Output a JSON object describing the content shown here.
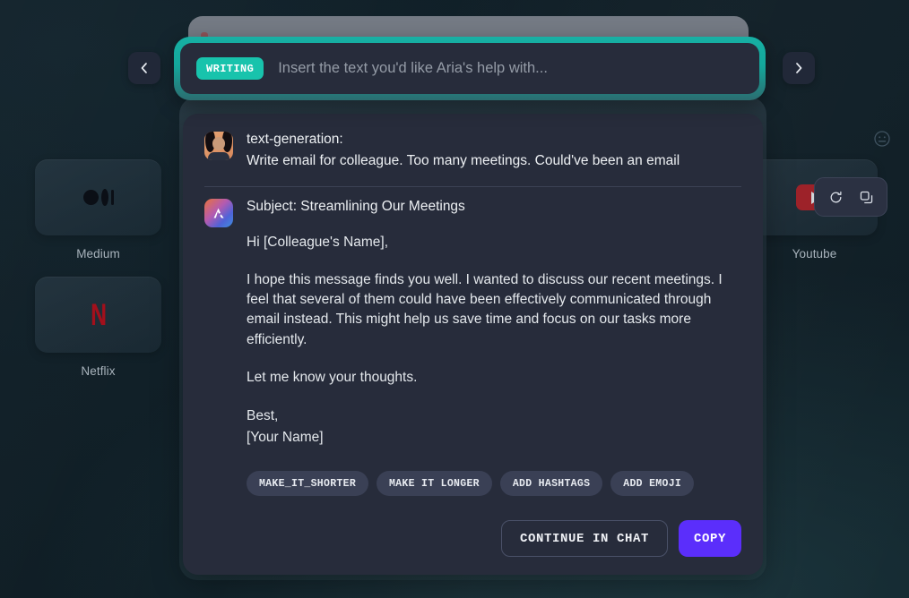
{
  "colors": {
    "background": "#0e1b22",
    "panel": "#272c3b",
    "accent_teal": "#18c3ac",
    "accent_purple": "#5b2efb",
    "chip": "#3a4055",
    "netflix_red": "#a3101c",
    "youtube_red": "#9d2229"
  },
  "nav": {
    "prev_icon": "chevron-left-icon",
    "next_icon": "chevron-right-icon"
  },
  "smiley": {
    "icon": "smiley-face-icon"
  },
  "shortcuts": {
    "left": [
      {
        "label": "Medium",
        "icon": "medium-logo-icon"
      },
      {
        "label": "Netflix",
        "icon": "netflix-logo-icon",
        "glyph": "N"
      }
    ],
    "right": [
      {
        "label": "Youtube",
        "icon": "youtube-logo-icon"
      }
    ]
  },
  "prompt_bar": {
    "badge": "WRITING",
    "placeholder": "Insert the text you'd like Aria's help with...",
    "value": ""
  },
  "conversation": {
    "user": {
      "avatar": "user-avatar",
      "title": "text-generation:",
      "text": "Write email for colleague. Too many meetings. Could've been an email"
    },
    "actions": {
      "refresh_icon": "refresh-icon",
      "copy_icon": "copy-icon"
    },
    "assistant": {
      "avatar": "aria-avatar",
      "subject": "Subject: Streamlining Our Meetings",
      "paragraphs": [
        "Hi [Colleague's Name],",
        "I hope this message finds you well. I wanted to discuss our recent meetings. I feel that several of them could have been effectively communicated through email instead. This might help us save time and focus on our tasks more efficiently.",
        "Let me know your thoughts."
      ],
      "signoff_line_1": "Best,",
      "signoff_line_2": "[Your Name]"
    },
    "chips": [
      "MAKE_IT_SHORTER",
      "MAKE IT LONGER",
      "ADD HASHTAGS",
      "ADD EMOJI"
    ],
    "footer": {
      "continue_label": "CONTINUE IN CHAT",
      "copy_label": "COPY"
    }
  }
}
